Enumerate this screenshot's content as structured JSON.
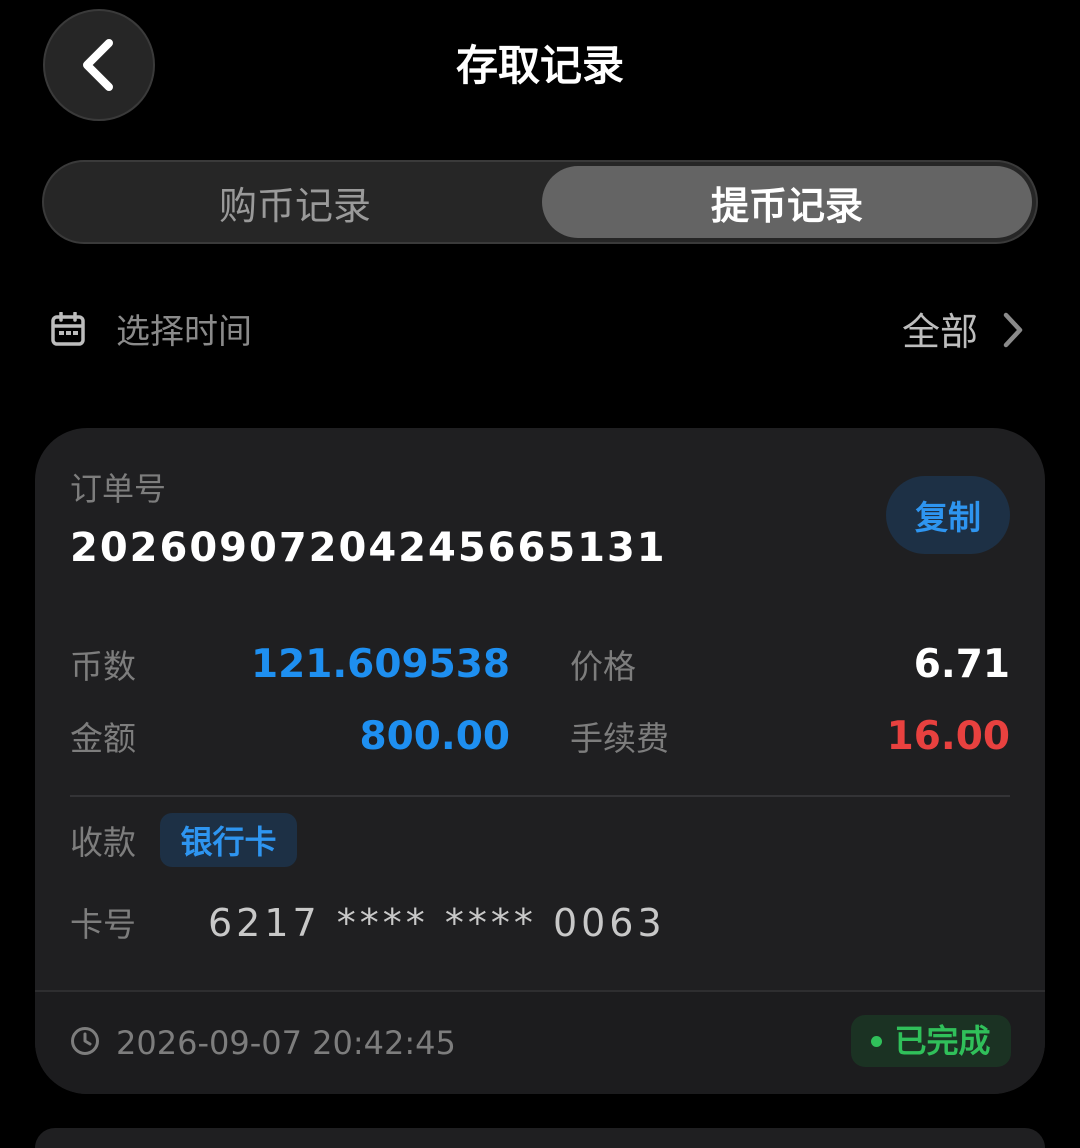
{
  "header": {
    "title": "存取记录",
    "back_icon": "chevron-left-icon"
  },
  "tabs": [
    {
      "label": "购币记录",
      "active": false
    },
    {
      "label": "提币记录",
      "active": true
    }
  ],
  "filter": {
    "icon": "calendar-icon",
    "label": "选择时间",
    "value": "全部",
    "chevron_icon": "chevron-right-icon"
  },
  "record": {
    "order_label": "订单号",
    "order_number": "20260907204245665131",
    "copy_label": "复制",
    "coins_label": "币数",
    "coins_value": "121.609538",
    "price_label": "价格",
    "price_value": "6.71",
    "amount_label": "金额",
    "amount_value": "800.00",
    "fee_label": "手续费",
    "fee_value": "16.00",
    "receive_label": "收款",
    "receive_method": "银行卡",
    "card_label": "卡号",
    "card_number": "6217 **** **** 0063",
    "clock_icon": "clock-icon",
    "timestamp": "2026-09-07 20:42:45",
    "status": "已完成"
  },
  "colors": {
    "accent_blue": "#1e8ff0",
    "fee_red": "#e8413f",
    "status_green": "#30c05a",
    "card_bg": "#1f1f21"
  }
}
